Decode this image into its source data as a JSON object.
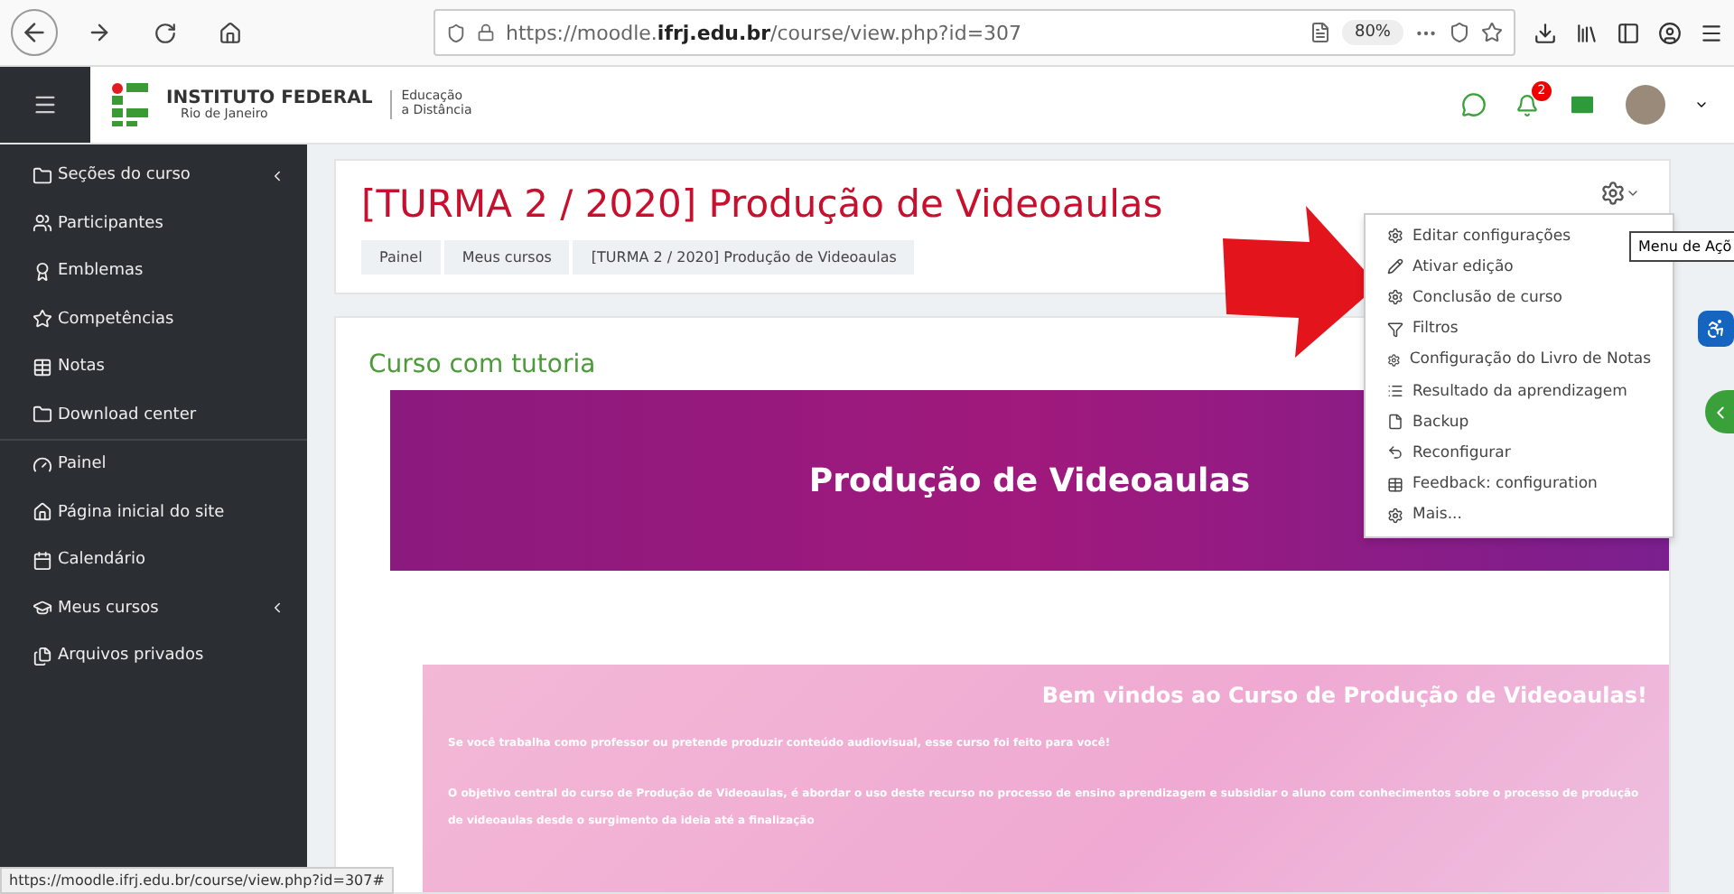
{
  "browser": {
    "url_prefix": "https://moodle.",
    "url_domain": "ifrj.edu.br",
    "url_path": "/course/view.php?id=307",
    "zoom": "80%"
  },
  "header": {
    "logo_name": "INSTITUTO FEDERAL",
    "logo_sub": "Rio de Janeiro",
    "logo_tag_1": "Educação",
    "logo_tag_2": "a Distância",
    "notification_count": "2"
  },
  "sidebar": {
    "items": [
      {
        "label": "Seções do curso",
        "expandable": true
      },
      {
        "label": "Participantes",
        "expandable": false
      },
      {
        "label": "Emblemas",
        "expandable": false
      },
      {
        "label": "Competências",
        "expandable": false
      },
      {
        "label": "Notas",
        "expandable": false
      },
      {
        "label": "Download center",
        "expandable": false
      },
      {
        "label": "Painel",
        "expandable": false
      },
      {
        "label": "Página inicial do site",
        "expandable": false
      },
      {
        "label": "Calendário",
        "expandable": false
      },
      {
        "label": "Meus cursos",
        "expandable": true
      },
      {
        "label": "Arquivos privados",
        "expandable": false
      }
    ]
  },
  "course": {
    "title": "[TURMA 2 / 2020] Produção de Videoaulas",
    "breadcrumb": [
      "Painel",
      "Meus cursos",
      "[TURMA 2 / 2020] Produção de Videoaulas"
    ]
  },
  "actions_menu": {
    "tooltip": "Menu de Açõ",
    "items": [
      "Editar configurações",
      "Ativar edição",
      "Conclusão de curso",
      "Filtros",
      "Configuração do Livro de Notas",
      "Resultado da aprendizagem",
      "Backup",
      "Reconfigurar",
      "Feedback: configuration",
      "Mais..."
    ]
  },
  "content": {
    "section_title": "Curso com tutoria",
    "banner_title": "Produção de Videoaulas",
    "welcome_title": "Bem vindos ao Curso de Produção de Videoaulas!",
    "paragraphs": [
      "Se você trabalha como professor ou pretende produzir conteúdo audiovisual, esse curso foi feito para você!",
      "O objetivo central do curso de Produção de Videoaulas, é abordar o uso deste recurso no processo de ensino aprendizagem e subsidiar o aluno com conhecimentos sobre o processo de produção de videoaulas desde o surgimento da ideia até a finalização"
    ]
  },
  "status_url": "https://moodle.ifrj.edu.br/course/view.php?id=307#"
}
